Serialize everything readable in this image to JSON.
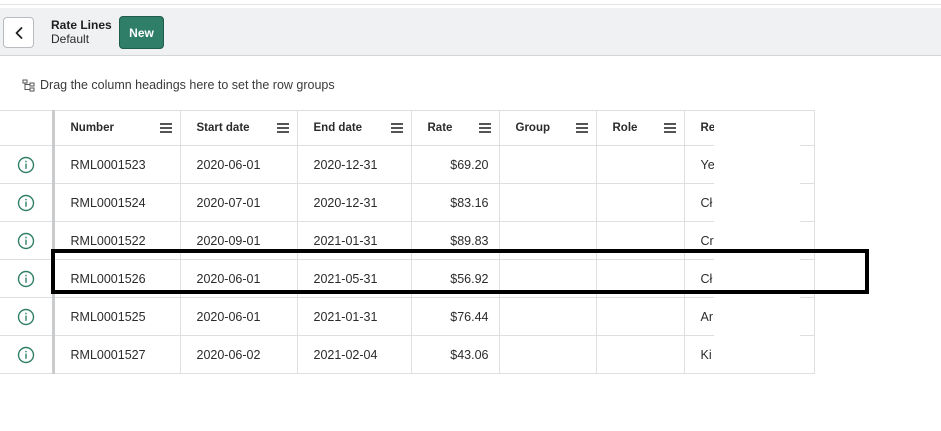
{
  "header": {
    "title": "Rate Lines",
    "subtitle": "Default",
    "new_label": "New"
  },
  "grouping": {
    "hint": "Drag the column headings here to set the row groups"
  },
  "table": {
    "columns": [
      "Number",
      "Start date",
      "End date",
      "Rate",
      "Group",
      "Role",
      "Re"
    ],
    "rows": [
      {
        "number": "RML0001523",
        "start": "2020-06-01",
        "end": "2020-12-31",
        "rate": "$69.20",
        "group": "",
        "role": "",
        "res": "Ye"
      },
      {
        "number": "RML0001524",
        "start": "2020-07-01",
        "end": "2020-12-31",
        "rate": "$83.16",
        "group": "",
        "role": "",
        "res": "Cł"
      },
      {
        "number": "RML0001522",
        "start": "2020-09-01",
        "end": "2021-01-31",
        "rate": "$89.83",
        "group": "",
        "role": "",
        "res": "Cr"
      },
      {
        "number": "RML0001526",
        "start": "2020-06-01",
        "end": "2021-05-31",
        "rate": "$56.92",
        "group": "",
        "role": "",
        "res": "Cł"
      },
      {
        "number": "RML0001525",
        "start": "2020-06-01",
        "end": "2021-01-31",
        "rate": "$76.44",
        "group": "",
        "role": "",
        "res": "Ar"
      },
      {
        "number": "RML0001527",
        "start": "2020-06-02",
        "end": "2021-02-04",
        "rate": "$43.06",
        "group": "",
        "role": "",
        "res": "Ki"
      }
    ]
  },
  "colors": {
    "accent": "#2f7f68",
    "header_bg": "#f0f1f2",
    "highlight": "#000000"
  },
  "icons": {
    "back": "chevron-left-icon",
    "group": "row-group-icon",
    "info": "info-circle-icon",
    "column_menu": "hamburger-menu-icon"
  }
}
